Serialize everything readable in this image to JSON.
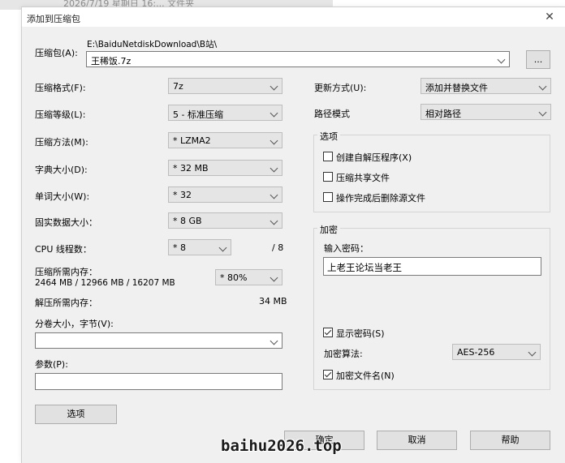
{
  "background": {
    "text": "2026/7/19 星期日 16:... 文件夹"
  },
  "dialog": {
    "title": "添加到压缩包",
    "close_glyph": "✕"
  },
  "archive": {
    "label": "压缩包(A):",
    "path": "E:\\BaiduNetdiskDownload\\B站\\",
    "value": "王稀饭.7z",
    "browse_label": "..."
  },
  "left": {
    "format": {
      "label": "压缩格式(F):",
      "value": "7z"
    },
    "level": {
      "label": "压缩等级(L):",
      "value": "5 - 标准压缩"
    },
    "method": {
      "label": "压缩方法(M):",
      "value": "* LZMA2"
    },
    "dict": {
      "label": "字典大小(D):",
      "value": "* 32 MB"
    },
    "word": {
      "label": "单词大小(W):",
      "value": "* 32"
    },
    "solid": {
      "label": "固实数据大小：",
      "value": "* 8 GB"
    },
    "threads": {
      "label": "CPU 线程数：",
      "value": "* 8",
      "total": "/ 8"
    },
    "mem_compress": {
      "label": "压缩所需内存：",
      "detail": "2464 MB / 12966 MB / 16207 MB",
      "value": "* 80%"
    },
    "mem_decompress": {
      "label": "解压所需内存：",
      "value": "34 MB"
    },
    "volume": {
      "label": "分卷大小，字节(V):",
      "value": ""
    },
    "params": {
      "label": "参数(P):",
      "value": ""
    },
    "options_button": "选项"
  },
  "right": {
    "update": {
      "label": "更新方式(U):",
      "value": "添加并替换文件"
    },
    "path_mode": {
      "label": "路径模式",
      "value": "相对路径"
    },
    "options_group": {
      "title": "选项",
      "items": [
        {
          "label": "创建自解压程序(X)",
          "checked": false
        },
        {
          "label": "压缩共享文件",
          "checked": false
        },
        {
          "label": "操作完成后删除源文件",
          "checked": false
        }
      ]
    },
    "encryption": {
      "title": "加密",
      "password_label": "输入密码：",
      "password_value": "上老王论坛当老王",
      "show_password": {
        "label": "显示密码(S)",
        "checked": true
      },
      "method_label": "加密算法:",
      "method_value": "AES-256",
      "encrypt_names": {
        "label": "加密文件名(N)",
        "checked": true
      }
    }
  },
  "buttons": {
    "ok": "确定",
    "cancel": "取消",
    "help": "帮助"
  },
  "watermark": "baihu2026.top"
}
